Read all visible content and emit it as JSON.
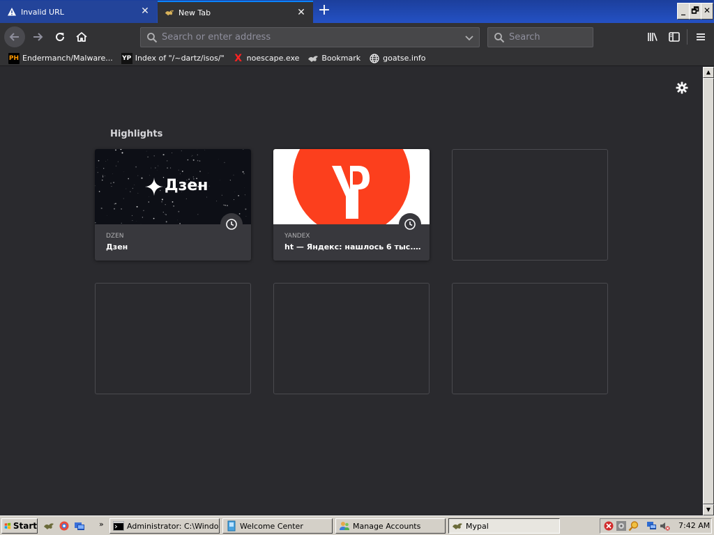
{
  "tabs": [
    {
      "label": "Invalid URL",
      "icon": "warning-icon"
    },
    {
      "label": "New Tab",
      "icon": "mypal-icon"
    }
  ],
  "window_controls": {
    "minimize": "_",
    "maximize": "🗗",
    "close": "✕"
  },
  "navbar": {
    "url_placeholder": "Search or enter address",
    "search_placeholder": "Search"
  },
  "bookmarks": [
    {
      "label": "Endermanch/Malware...",
      "icon_text": "PH"
    },
    {
      "label": "Index of \"/~dartz/isos/\"",
      "icon_text": "YP"
    },
    {
      "label": "noescape.exe",
      "icon_text": "X"
    },
    {
      "label": "Bookmark",
      "icon_text": ""
    },
    {
      "label": "goatse.info",
      "icon_text": ""
    }
  ],
  "content": {
    "section_title": "Highlights",
    "cards": [
      {
        "host": "DZEN",
        "title": "Дзен",
        "logo_text": "Дзен"
      },
      {
        "host": "YANDEX",
        "title": "ht — Яндекс: нашлось 6 тыс. р..."
      }
    ]
  },
  "taskbar": {
    "start_label": "Start",
    "more_label": "»",
    "tasks": [
      {
        "label": "Administrator: C:\\Windo..."
      },
      {
        "label": "Welcome Center"
      },
      {
        "label": "Manage Accounts"
      },
      {
        "label": "Mypal"
      }
    ],
    "clock": "7:42 AM"
  },
  "colors": {
    "accent": "#0a84ff",
    "yandex_red": "#fc3f1d",
    "tab_strip": "#2451c4",
    "content_bg": "#2a2a2e"
  }
}
